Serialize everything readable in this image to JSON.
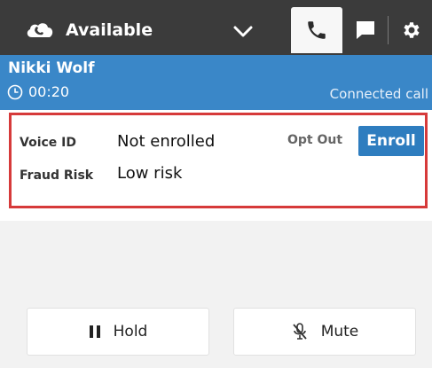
{
  "status": {
    "label": "Available",
    "icon": "cloud-phone-icon"
  },
  "tabs": [
    {
      "name": "phone",
      "icon": "phone-icon",
      "active": true
    },
    {
      "name": "chat",
      "icon": "chat-icon",
      "active": false
    },
    {
      "name": "settings",
      "icon": "gear-icon",
      "active": false
    }
  ],
  "contact": {
    "name": "Nikki Wolf",
    "timer": "00:20",
    "state": "Connected call"
  },
  "voice_id": {
    "label": "Voice ID",
    "value": "Not enrolled",
    "opt_out_label": "Opt Out",
    "enroll_label": "Enroll"
  },
  "fraud_risk": {
    "label": "Fraud Risk",
    "value": "Low risk"
  },
  "controls": {
    "hold_label": "Hold",
    "mute_label": "Mute"
  },
  "colors": {
    "topbar": "#3b3b3b",
    "contact_header": "#3a87c8",
    "enroll_button": "#2e7dbf",
    "highlight_border": "#d63a3a"
  }
}
